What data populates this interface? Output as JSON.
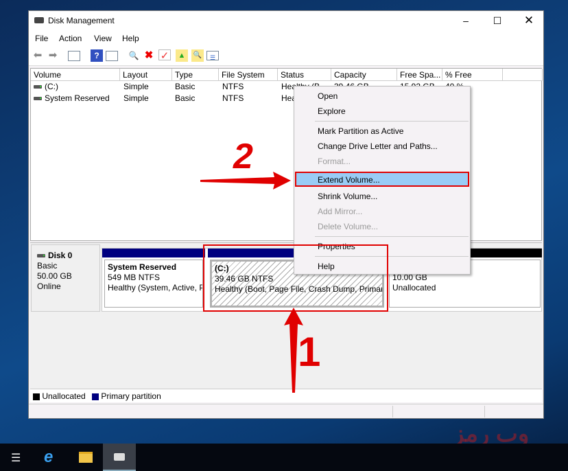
{
  "window": {
    "title": "Disk Management",
    "icon": "disk-management-icon",
    "controls": [
      "minimize",
      "maximize",
      "close"
    ]
  },
  "menubar": [
    "File",
    "Action",
    "View",
    "Help"
  ],
  "toolbar": [
    "back-icon",
    "forward-icon",
    "show-hide-console-tree-icon",
    "help-icon",
    "show-hide-action-pane-icon",
    "connect-disk-icon",
    "delete-icon",
    "check-icon",
    "folder-up-icon",
    "folder-search-icon",
    "properties-list-icon"
  ],
  "volume_list": {
    "columns": [
      "Volume",
      "Layout",
      "Type",
      "File System",
      "Status",
      "Capacity",
      "Free Spa...",
      "% Free"
    ],
    "rows": [
      [
        "(C:)",
        "Simple",
        "Basic",
        "NTFS",
        "Healthy (B...",
        "39.46 GB",
        "15.92 GB",
        "40 %"
      ],
      [
        "System Reserved",
        "Simple",
        "Basic",
        "NTFS",
        "Hea",
        "",
        "",
        ""
      ]
    ]
  },
  "disk": {
    "name": "Disk 0",
    "type": "Basic",
    "size": "50.00 GB",
    "status": "Online",
    "partitions": [
      {
        "name": "System Reserved",
        "size": "549 MB NTFS",
        "status": "Healthy (System, Active, P",
        "color": "#000080"
      },
      {
        "name": "(C:)",
        "size": "39.46 GB NTFS",
        "status": "Healthy (Boot, Page File, Crash Dump, Primary",
        "color": "#000080"
      },
      {
        "name": "",
        "size": "10.00 GB",
        "status": "Unallocated",
        "color": "#000000"
      }
    ]
  },
  "legend": [
    {
      "label": "Unallocated",
      "color": "#000000"
    },
    {
      "label": "Primary partition",
      "color": "#000080"
    }
  ],
  "context_menu": {
    "items": [
      {
        "label": "Open",
        "enabled": true
      },
      {
        "label": "Explore",
        "enabled": true
      },
      {
        "label": "Mark Partition as Active",
        "enabled": true
      },
      {
        "label": "Change Drive Letter and Paths...",
        "enabled": true
      },
      {
        "label": "Format...",
        "enabled": false
      },
      {
        "label": "Extend Volume...",
        "enabled": true,
        "highlighted": true
      },
      {
        "label": "Shrink Volume...",
        "enabled": true
      },
      {
        "label": "Add Mirror...",
        "enabled": false
      },
      {
        "label": "Delete Volume...",
        "enabled": false
      },
      {
        "label": "Properties",
        "enabled": true
      },
      {
        "label": "Help",
        "enabled": true
      }
    ]
  },
  "annotations": {
    "step1": "1",
    "step2": "2",
    "highlight_color": "#e00000"
  },
  "watermark": "وب رمز",
  "taskbar": [
    "task-view-icon",
    "internet-explorer-icon",
    "file-explorer-icon",
    "disk-management-icon"
  ]
}
